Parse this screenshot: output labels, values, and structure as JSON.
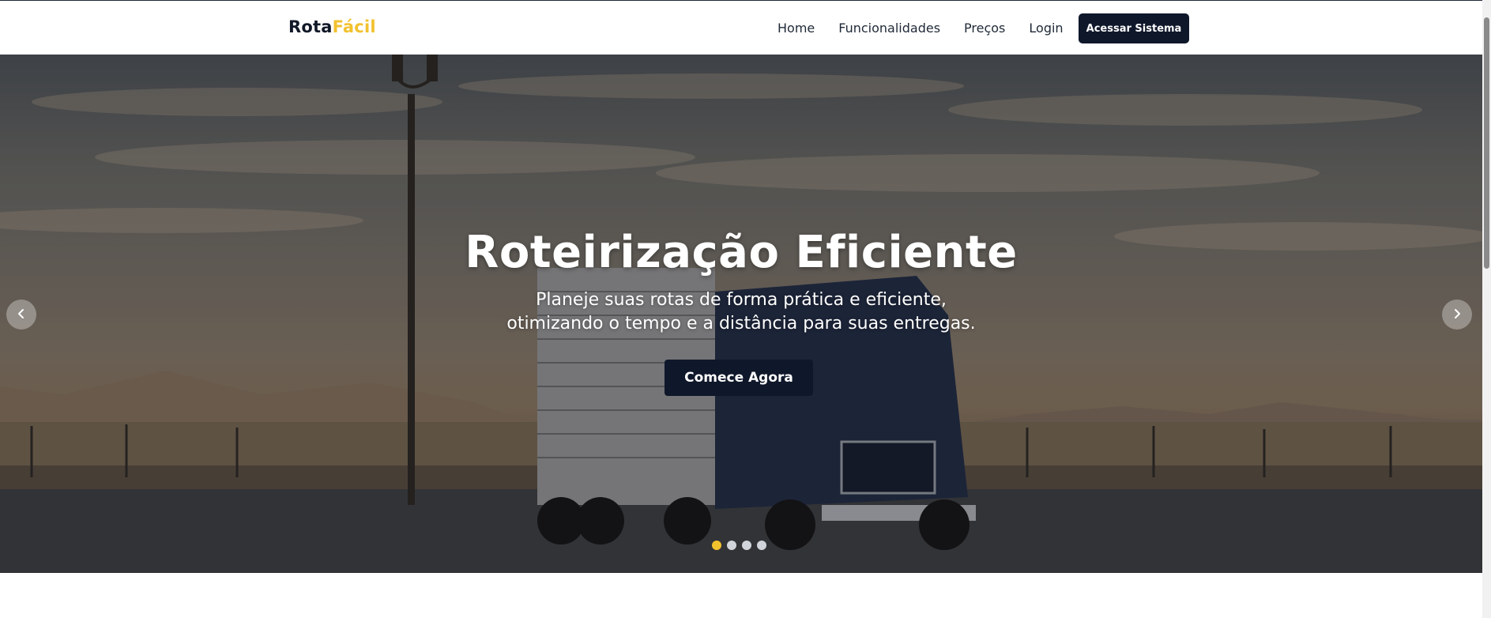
{
  "brand": {
    "part1": "Rota",
    "part2": "Fácil"
  },
  "nav": {
    "links": [
      "Home",
      "Funcionalidades",
      "Preços",
      "Login"
    ],
    "cta": "Acessar Sistema"
  },
  "hero": {
    "title": "Roteirização Eficiente",
    "subtitle_line1": "Planeje suas rotas de forma prática e eficiente,",
    "subtitle_line2": "otimizando o tempo e a distância para suas entregas.",
    "button": "Comece Agora",
    "slide_count": 4,
    "active_slide": 1
  },
  "colors": {
    "accent": "#f2c12e",
    "primary_dark": "#0f172a",
    "text": "#111827"
  },
  "icons": {
    "prev": "chevron-left-icon",
    "next": "chevron-right-icon"
  }
}
